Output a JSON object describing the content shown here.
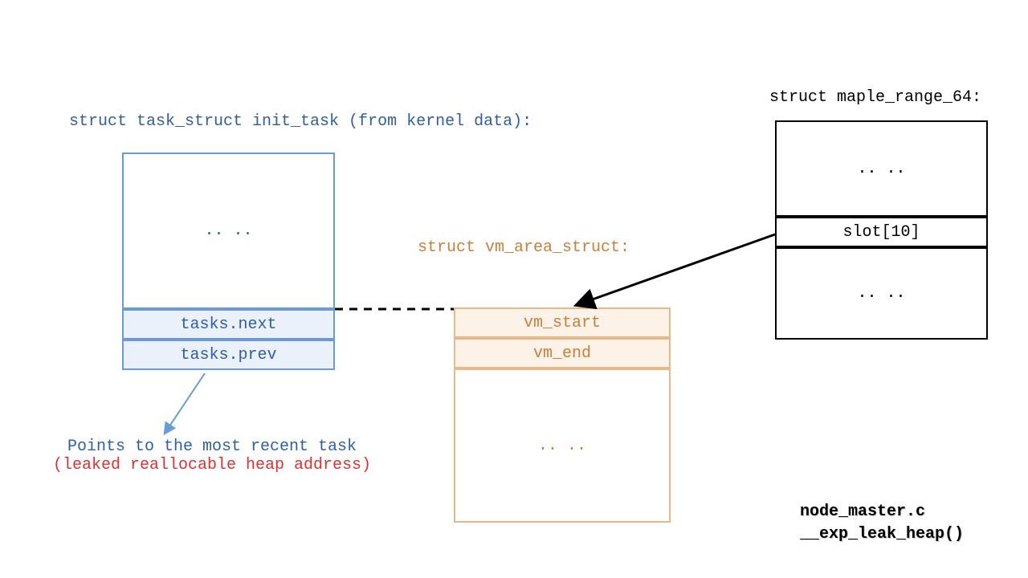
{
  "task_struct": {
    "title": "struct task_struct init_task (from kernel data):",
    "ellipsis": ".. ..",
    "tasks_next": "tasks.next",
    "tasks_prev": "tasks.prev"
  },
  "annotation": {
    "line1": "Points to the most recent task",
    "line2": "(leaked reallocable heap address)"
  },
  "vm_area": {
    "title": "struct vm_area_struct:",
    "vm_start": "vm_start",
    "vm_end": "vm_end",
    "ellipsis": ".. .."
  },
  "maple": {
    "title": "struct maple_range_64:",
    "ellipsis_top": ".. ..",
    "slot": "slot[10]",
    "ellipsis_bottom": ".. .."
  },
  "footer": {
    "file": "node_master.c",
    "func": "__exp_leak_heap()"
  }
}
